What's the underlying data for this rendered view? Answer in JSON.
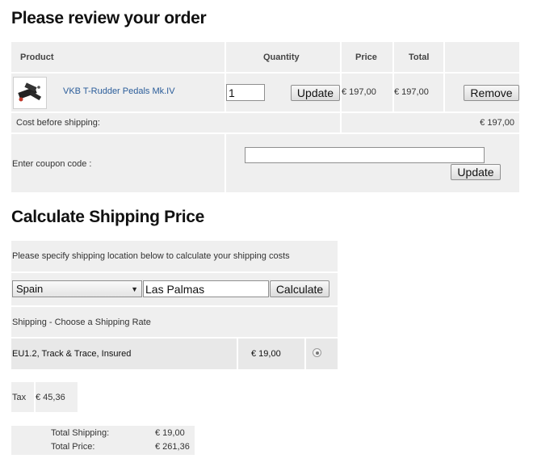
{
  "order": {
    "title": "Please review your order",
    "columns": {
      "product": "Product",
      "quantity": "Quantity",
      "price": "Price",
      "total": "Total"
    },
    "item": {
      "name": "VKB T-Rudder Pedals Mk.IV",
      "quantity": "1",
      "update_label": "Update",
      "price": "€ 197,00",
      "total": "€ 197,00",
      "remove_label": "Remove",
      "thumbnail_icon": "rudder-pedals-thumbnail"
    },
    "cost_before_shipping_label": "Cost before shipping:",
    "cost_before_shipping_value": "€ 197,00",
    "coupon_label": "Enter coupon code :",
    "coupon_value": "",
    "coupon_update_label": "Update"
  },
  "shipping": {
    "title": "Calculate Shipping Price",
    "instructions": "Please specify shipping location below to calculate your shipping costs",
    "country": "Spain",
    "city": "Las Palmas",
    "calculate_label": "Calculate",
    "rate_header": "Shipping - Choose a Shipping Rate",
    "rate": {
      "name": "EU1.2, Track & Trace, Insured",
      "price": "€ 19,00",
      "selected": true
    }
  },
  "tax": {
    "label": "Tax",
    "value": "€ 45,36"
  },
  "totals": {
    "shipping_label": "Total Shipping:",
    "shipping_value": "€ 19,00",
    "price_label": "Total Price:",
    "price_value": "€ 261,36"
  },
  "colors": {
    "cell_bg": "#efefef",
    "link": "#2b5d9a",
    "heading": "#111111"
  }
}
